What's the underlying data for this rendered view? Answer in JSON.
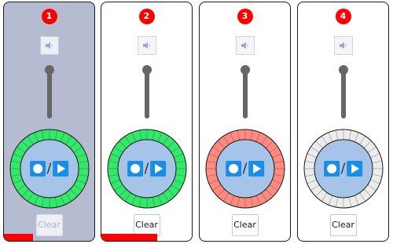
{
  "colors": {
    "ring_fill_green": "#33e86a",
    "ring_fill_red": "#ff8a80",
    "ring_fill_empty": "#ececec",
    "inner_circle": "#a6c4e8",
    "control_blue": "#1a8ee6",
    "badge_red": "#ff0000",
    "progress_red": "#ff0000",
    "active_panel_bg": "#b5bcd1"
  },
  "tracks": [
    {
      "number": "1",
      "ring_color": "#33e86a",
      "state": "active",
      "clear_label": "Clear",
      "clear_enabled": false,
      "progress": 0.32,
      "volume": 1.0
    },
    {
      "number": "2",
      "ring_color": "#33e86a",
      "state": "idle",
      "clear_label": "Clear",
      "clear_enabled": true,
      "progress": 0.62,
      "volume": 1.0
    },
    {
      "number": "3",
      "ring_color": "#ff8a80",
      "state": "idle",
      "clear_label": "Clear",
      "clear_enabled": true,
      "progress": 0,
      "volume": 1.0
    },
    {
      "number": "4",
      "ring_color": "#ececec",
      "state": "idle",
      "clear_label": "Clear",
      "clear_enabled": true,
      "progress": 0,
      "volume": 1.0
    }
  ]
}
